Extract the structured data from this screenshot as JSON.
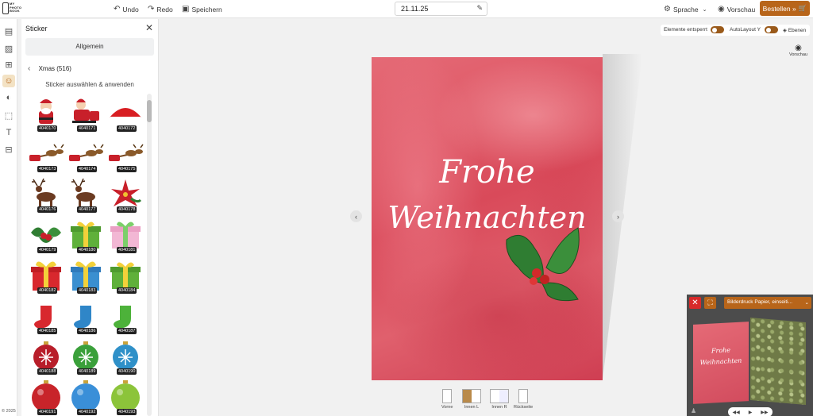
{
  "app": {
    "logo_text": [
      "MY",
      "PHOTO",
      "BOOK"
    ],
    "copyright": "© 2025"
  },
  "toolbar": {
    "undo_label": "Undo",
    "redo_label": "Redo",
    "save_label": "Speichern",
    "date_value": "21.11.25",
    "language_label": "Sprache",
    "preview_label": "Vorschau",
    "order_label": "Bestellen »"
  },
  "sticker_panel": {
    "title": "Sticker",
    "general_label": "Allgemein",
    "category_label": "Xmas (516)",
    "apply_label": "Sticker auswählen & anwenden",
    "stickers": [
      {
        "code": "4040170",
        "icon": "santa"
      },
      {
        "code": "4040171",
        "icon": "santa-sleigh"
      },
      {
        "code": "4040172",
        "icon": "santa-hat"
      },
      {
        "code": "4040173",
        "icon": "sleigh-reindeer"
      },
      {
        "code": "4040174",
        "icon": "sleigh-reindeer"
      },
      {
        "code": "4040175",
        "icon": "sleigh-reindeer"
      },
      {
        "code": "4040176",
        "icon": "reindeer"
      },
      {
        "code": "4040177",
        "icon": "reindeer"
      },
      {
        "code": "4040178",
        "icon": "poinsettia"
      },
      {
        "code": "4040179",
        "icon": "holly"
      },
      {
        "code": "4040180",
        "icon": "gift-green"
      },
      {
        "code": "4040181",
        "icon": "gift-pink"
      },
      {
        "code": "4040182",
        "icon": "gift-red"
      },
      {
        "code": "4040183",
        "icon": "gift-blue"
      },
      {
        "code": "4040184",
        "icon": "gift-green"
      },
      {
        "code": "4040185",
        "icon": "stocking-red"
      },
      {
        "code": "4040186",
        "icon": "stocking-blue"
      },
      {
        "code": "4040187",
        "icon": "stocking-green"
      },
      {
        "code": "4040188",
        "icon": "ornament-red"
      },
      {
        "code": "4040189",
        "icon": "ornament-green"
      },
      {
        "code": "4040190",
        "icon": "ornament-blue"
      },
      {
        "code": "4040191",
        "icon": "ball-red"
      },
      {
        "code": "4040192",
        "icon": "ball-blue"
      },
      {
        "code": "4040193",
        "icon": "ball-green"
      }
    ]
  },
  "canvas": {
    "elements_unlocked_label": "Elemente entsperrt",
    "autolayout_label": "AutoLayout Y",
    "layers_label": "Ebenen",
    "side_preview_label": "Vorschau",
    "card_text_line1": "Frohe",
    "card_text_line2": "Weihnachten",
    "pages": [
      {
        "label": "Vorne"
      },
      {
        "label": "Innen L"
      },
      {
        "label": "Innen R"
      },
      {
        "label": "Rückseite"
      }
    ]
  },
  "mini_preview": {
    "paper_select": "Bilderdruck Papier, einseiti...",
    "card_text_line1": "Frohe",
    "card_text_line2": "Weihnachten"
  },
  "colors": {
    "accent": "#b8651a",
    "close": "#d82a2a",
    "card": "#d94a5a"
  }
}
